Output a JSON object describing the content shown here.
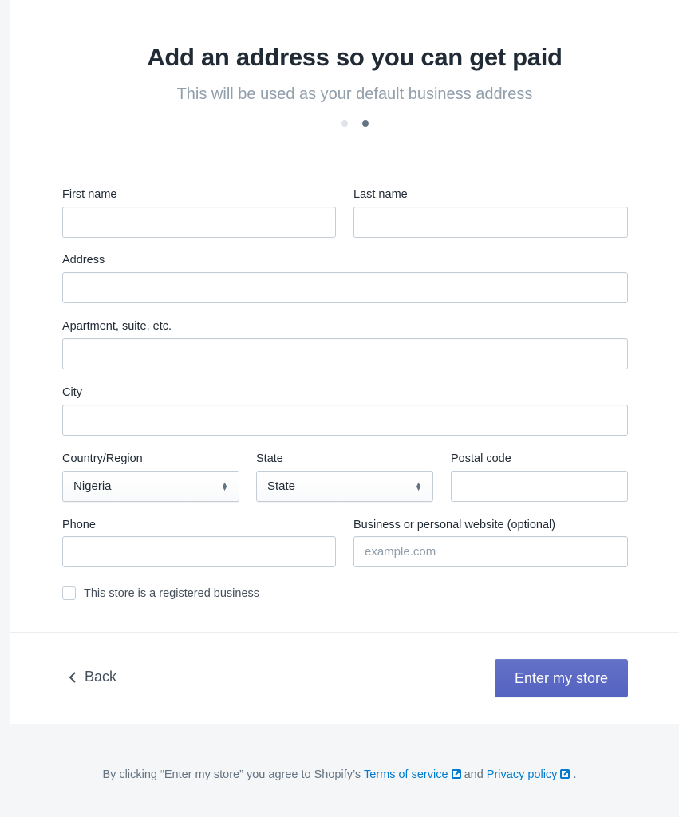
{
  "header": {
    "title": "Add an address so you can get paid",
    "subtitle": "This will be used as your default business address",
    "steps": {
      "total": 2,
      "current": 2
    }
  },
  "form": {
    "first_name": {
      "label": "First name",
      "value": "",
      "placeholder": ""
    },
    "last_name": {
      "label": "Last name",
      "value": "",
      "placeholder": ""
    },
    "address": {
      "label": "Address",
      "value": "",
      "placeholder": ""
    },
    "apartment": {
      "label": "Apartment, suite, etc.",
      "value": "",
      "placeholder": ""
    },
    "city": {
      "label": "City",
      "value": "",
      "placeholder": ""
    },
    "country": {
      "label": "Country/Region",
      "selected": "Nigeria"
    },
    "state": {
      "label": "State",
      "selected": "State"
    },
    "postal_code": {
      "label": "Postal code",
      "value": "",
      "placeholder": ""
    },
    "phone": {
      "label": "Phone",
      "value": "",
      "placeholder": ""
    },
    "website": {
      "label": "Business or personal website (optional)",
      "value": "",
      "placeholder": "example.com"
    },
    "registered_business": {
      "label": "This store is a registered business",
      "checked": false
    }
  },
  "actions": {
    "back_label": "Back",
    "submit_label": "Enter my store",
    "accent_color": "#5c6ac4"
  },
  "footer": {
    "prefix": "By clicking “Enter my store” you agree to Shopify’s",
    "terms_label": "Terms of service",
    "middle": "and",
    "privacy_label": "Privacy policy",
    "suffix": ".",
    "link_color": "#007ace"
  }
}
